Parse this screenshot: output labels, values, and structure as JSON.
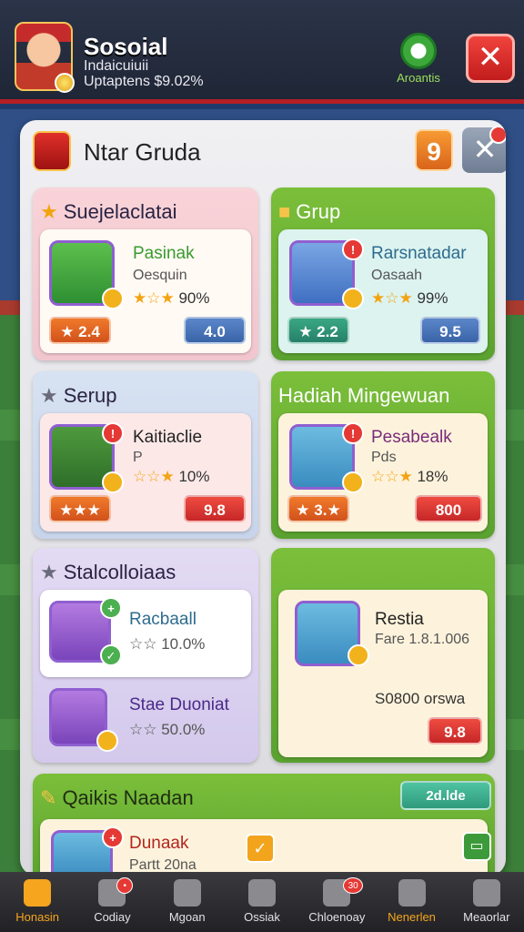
{
  "header": {
    "player_name": "Sosoial",
    "player_line1": "Indaicuiuii",
    "player_line2": "Uptaptens $9.02%",
    "achievements_label": "Aroantis"
  },
  "panel": {
    "title": "Ntar Gruda",
    "count": "9"
  },
  "sections": {
    "s1": {
      "title": "Suejelaclatai",
      "name": "Pasinak",
      "sub": "Oesquin",
      "rate_stars": "★☆★",
      "rate_pct": "90%",
      "left_pill": "★ 2.4",
      "right_pill": "4.0"
    },
    "s2": {
      "title": "Grup",
      "name": "Rarsnatadar",
      "sub": "Oasaah",
      "rate_stars": "★☆★",
      "rate_pct": "99%",
      "left_pill": "★ 2.2",
      "right_pill": "9.5"
    },
    "s3": {
      "title": "Serup",
      "name": "Kaitiaclie",
      "sub": "P",
      "rate_stars": "☆☆★",
      "rate_pct": "10%",
      "left_pill": "★★★",
      "right_pill": "9.8"
    },
    "s4": {
      "title": "Hadiah Mingewuan",
      "name": "Pesabealk",
      "sub": "Pds",
      "rate_stars": "☆☆★",
      "rate_pct": "18%",
      "left_pill": "★ 3.★",
      "right_pill": "800"
    },
    "s5": {
      "title": "Stalcolloiaas",
      "name1": "Racbaall",
      "rate1": "☆☆ 10.0%",
      "name2": "Stae Duoniat",
      "rate2": "☆☆ 50.0%"
    },
    "s6": {
      "name": "Restia",
      "sub": "Fare 1.8.1.006",
      "footer_text": "S0800 orswa",
      "pill": "9.8"
    },
    "s7": {
      "title": "Qaikis Naadan",
      "button": "2d.lde",
      "name": "Dunaak",
      "sub": "Partt 20na"
    }
  },
  "nav": [
    {
      "label": "Honasin"
    },
    {
      "label": "Codiay",
      "badge": ""
    },
    {
      "label": "Mgoan"
    },
    {
      "label": "Ossiak"
    },
    {
      "label": "Chloenoay",
      "badge": "30"
    },
    {
      "label": "Nenerlen"
    },
    {
      "label": "Meaorlar"
    }
  ]
}
